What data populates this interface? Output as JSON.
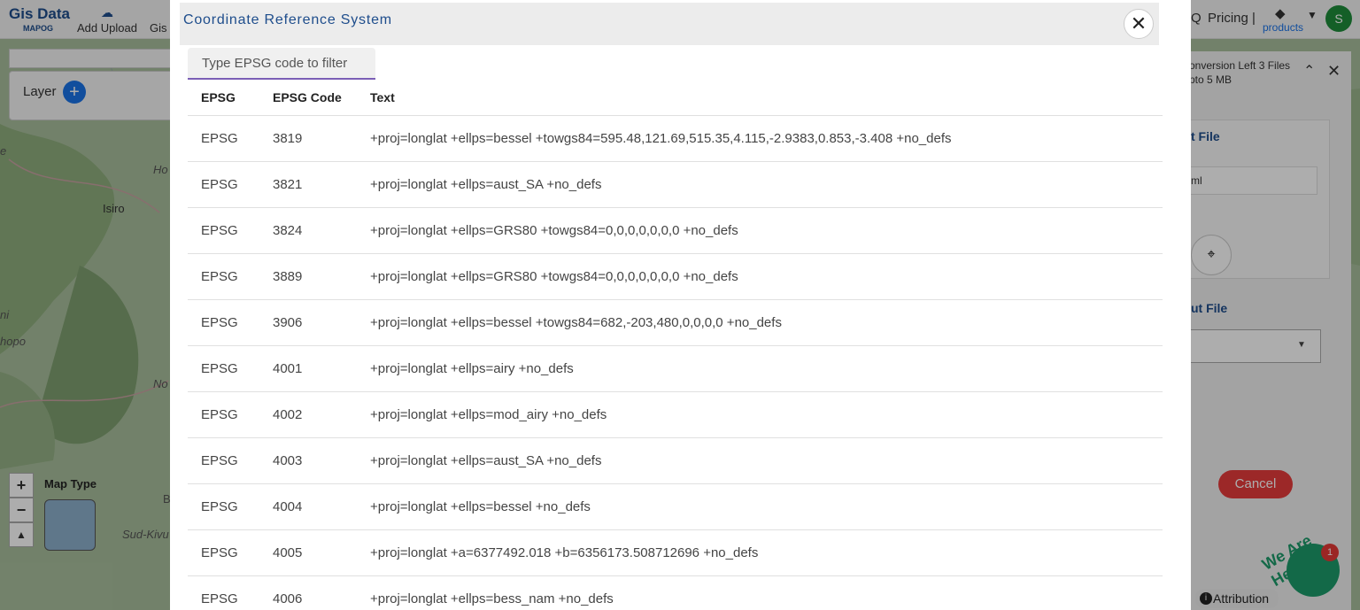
{
  "background": {
    "logo": {
      "title": "Gis Data",
      "subtitle": "MAPOG"
    },
    "nav": {
      "add_upload": "Add Upload",
      "gis": "Gis",
      "faq_fragment": "Q",
      "pricing": "Pricing |",
      "products": "products",
      "avatar_letter": "S"
    },
    "layer_panel": {
      "label": "Layer"
    },
    "map": {
      "map_type_label": "Map Type",
      "labels": [
        "Isiro",
        "Ho",
        "Sud-Kivu",
        "hopo",
        "No",
        "ni",
        "e",
        "B"
      ]
    },
    "right_panel": {
      "conversion_line1": "onversion Left 3 Files",
      "conversion_line2": "pto 5 MB",
      "input_file": "t File",
      "input_value": "ml",
      "output_file": "ut File",
      "cancel": "Cancel",
      "attribution": "Attribution",
      "we_are_here": "We Are Here!",
      "chat_badge": "1"
    }
  },
  "modal": {
    "title": "Coordinate Reference System",
    "close_symbol": "✕",
    "filter_placeholder": "Type EPSG code to filter",
    "columns": [
      "EPSG",
      "EPSG Code",
      "Text"
    ],
    "rows": [
      {
        "epsg": "EPSG",
        "code": "3819",
        "text": "+proj=longlat +ellps=bessel +towgs84=595.48,121.69,515.35,4.115,-2.9383,0.853,-3.408 +no_defs"
      },
      {
        "epsg": "EPSG",
        "code": "3821",
        "text": "+proj=longlat +ellps=aust_SA +no_defs"
      },
      {
        "epsg": "EPSG",
        "code": "3824",
        "text": "+proj=longlat +ellps=GRS80 +towgs84=0,0,0,0,0,0,0 +no_defs"
      },
      {
        "epsg": "EPSG",
        "code": "3889",
        "text": "+proj=longlat +ellps=GRS80 +towgs84=0,0,0,0,0,0,0 +no_defs"
      },
      {
        "epsg": "EPSG",
        "code": "3906",
        "text": "+proj=longlat +ellps=bessel +towgs84=682,-203,480,0,0,0,0 +no_defs"
      },
      {
        "epsg": "EPSG",
        "code": "4001",
        "text": "+proj=longlat +ellps=airy +no_defs"
      },
      {
        "epsg": "EPSG",
        "code": "4002",
        "text": "+proj=longlat +ellps=mod_airy +no_defs"
      },
      {
        "epsg": "EPSG",
        "code": "4003",
        "text": "+proj=longlat +ellps=aust_SA +no_defs"
      },
      {
        "epsg": "EPSG",
        "code": "4004",
        "text": "+proj=longlat +ellps=bessel +no_defs"
      },
      {
        "epsg": "EPSG",
        "code": "4005",
        "text": "+proj=longlat +a=6377492.018 +b=6356173.508712696 +no_defs"
      },
      {
        "epsg": "EPSG",
        "code": "4006",
        "text": "+proj=longlat +ellps=bess_nam +no_defs"
      }
    ]
  },
  "colors": {
    "accent": "#1e4d8c",
    "cancel": "#e63b3b",
    "filter_underline": "#7b5fb6"
  }
}
